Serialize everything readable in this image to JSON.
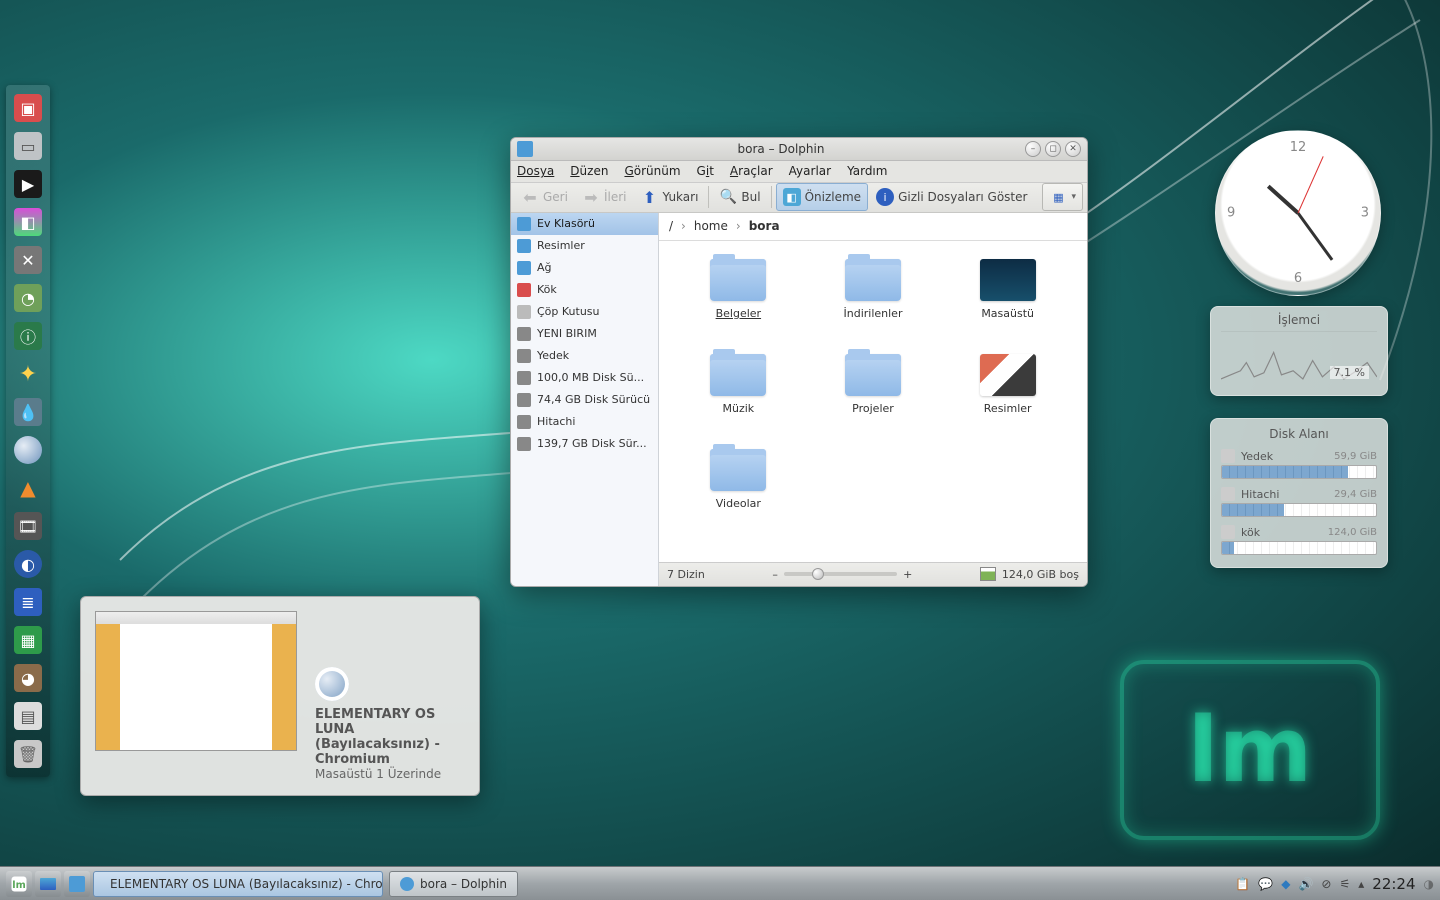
{
  "window": {
    "title": "bora – Dolphin",
    "menus": [
      "Dosya",
      "Düzen",
      "Görünüm",
      "Git",
      "Araçlar",
      "Ayarlar",
      "Yardım"
    ],
    "toolbar": {
      "back": "Geri",
      "forward": "İleri",
      "up": "Yukarı",
      "find": "Bul",
      "preview": "Önizleme",
      "showHidden": "Gizli Dosyaları Göster"
    },
    "breadcrumb": [
      "/",
      "home",
      "bora"
    ],
    "sidebar": [
      {
        "label": "Ev Klasörü",
        "color": "#4d9bd6",
        "sel": true
      },
      {
        "label": "Resimler",
        "color": "#4d9bd6"
      },
      {
        "label": "Ağ",
        "color": "#4d9bd6"
      },
      {
        "label": "Kök",
        "color": "#d94d4d"
      },
      {
        "label": "Çöp Kutusu",
        "color": "#bbb"
      },
      {
        "label": "YENI BIRIM",
        "color": "#888"
      },
      {
        "label": "Yedek",
        "color": "#888"
      },
      {
        "label": "100,0 MB Disk Sü...",
        "color": "#888"
      },
      {
        "label": "74,4 GB Disk Sürücü",
        "color": "#888"
      },
      {
        "label": "Hitachi",
        "color": "#888"
      },
      {
        "label": "139,7 GB Disk Sür...",
        "color": "#888"
      }
    ],
    "folders": [
      {
        "label": "Belgeler",
        "sel": true
      },
      {
        "label": "İndirilenler"
      },
      {
        "label": "Masaüstü",
        "thumb": "linear-gradient(#0d2c44,#174f6b)"
      },
      {
        "label": "Müzik"
      },
      {
        "label": "Projeler"
      },
      {
        "label": "Resimler",
        "thumb": "linear-gradient(135deg,#de6b52 0 30%,#fff 30% 55%,#3b3b3b 55%)"
      },
      {
        "label": "Videolar"
      }
    ],
    "status": {
      "left": "7 Dizin",
      "free": "124,0 GiB boş"
    }
  },
  "preview": {
    "title": "ELEMENTARY OS LUNA (Bayılacaksınız) - Chromium",
    "subtitle": "Masaüstü 1 Üzerinde"
  },
  "widgets": {
    "clock": {
      "h": 22,
      "m": 24
    },
    "cpu": {
      "title": "İşlemci",
      "value": "7.1 %"
    },
    "disk": {
      "title": "Disk Alanı",
      "rows": [
        {
          "name": "Yedek",
          "size": "59,9 GiB",
          "pct": 82
        },
        {
          "name": "Hitachi",
          "size": "29,4 GiB",
          "pct": 40
        },
        {
          "name": "kök",
          "size": "124,0 GiB",
          "pct": 8
        }
      ]
    }
  },
  "taskbar": {
    "tasks": [
      {
        "label": "ELEMENTARY OS LUNA (Bayılacaksınız) - Chro...",
        "active": true,
        "icon": "#6d93bc"
      },
      {
        "label": "bora – Dolphin",
        "icon": "#4d9bd6"
      }
    ],
    "clock": "22:24"
  }
}
